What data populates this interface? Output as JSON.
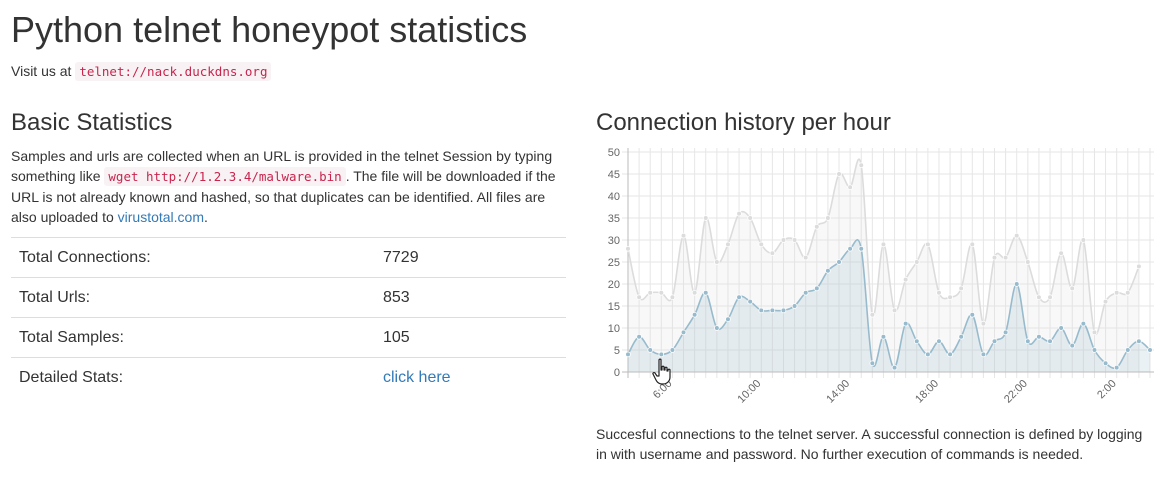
{
  "page": {
    "title": "Python telnet honeypot statistics",
    "visit_prefix": "Visit us at",
    "telnet_address": "telnet://nack.duckdns.org"
  },
  "basic": {
    "heading": "Basic Statistics",
    "desc_part1": "Samples and urls are collected when an URL is provided in the telnet Session by typing something like ",
    "desc_code": "wget http://1.2.3.4/malware.bin",
    "desc_part2": ". The file will be downloaded if the URL is not already known and hashed, so that duplicates can be identified. All files are also uploaded to ",
    "desc_link": "virustotal.com",
    "desc_end": ".",
    "rows": [
      {
        "label": "Total Connections:",
        "value": "7729"
      },
      {
        "label": "Total Urls:",
        "value": "853"
      },
      {
        "label": "Total Samples:",
        "value": "105"
      },
      {
        "label": "Detailed Stats:",
        "value": "click here"
      }
    ]
  },
  "history": {
    "heading": "Connection history per hour",
    "caption": "Succesful connections to the telnet server. A successful connection is defined by logging in with username and password. No further execution of commands is needed."
  },
  "chart_data": {
    "type": "area",
    "ylim": [
      0,
      50
    ],
    "yticks": [
      0,
      5,
      10,
      15,
      20,
      25,
      30,
      35,
      40,
      45,
      50
    ],
    "grid": true,
    "xtick_labels": [
      {
        "label": "6:00",
        "index": 4
      },
      {
        "label": "10:00",
        "index": 12
      },
      {
        "label": "14:00",
        "index": 20
      },
      {
        "label": "18:00",
        "index": 28
      },
      {
        "label": "22:00",
        "index": 36
      },
      {
        "label": "2:00",
        "index": 44
      }
    ],
    "series": [
      {
        "color": "#dcdcdc",
        "values": [
          28,
          17,
          18,
          18,
          17,
          31,
          18,
          35,
          25,
          29,
          36,
          35,
          29,
          27,
          30,
          30,
          26,
          33,
          35,
          45,
          42,
          47,
          13,
          29,
          14,
          21,
          25,
          29,
          18,
          17,
          19,
          29,
          11,
          26,
          26,
          31,
          25,
          17,
          17,
          27,
          19,
          30,
          9,
          16,
          18,
          18,
          24
        ]
      },
      {
        "color": "#97bbcd",
        "values": [
          4,
          8,
          5,
          4,
          5,
          9,
          13,
          18,
          10,
          12,
          17,
          16,
          14,
          14,
          14,
          15,
          18,
          19,
          23,
          25,
          28,
          28,
          2,
          8,
          1,
          11,
          7,
          4,
          7,
          4,
          8,
          13,
          4,
          7,
          9,
          20,
          7,
          8,
          7,
          10,
          6,
          11,
          5,
          2,
          1,
          5,
          7,
          5
        ]
      }
    ]
  },
  "icons": {
    "cursor": "hand-pointer-icon"
  }
}
